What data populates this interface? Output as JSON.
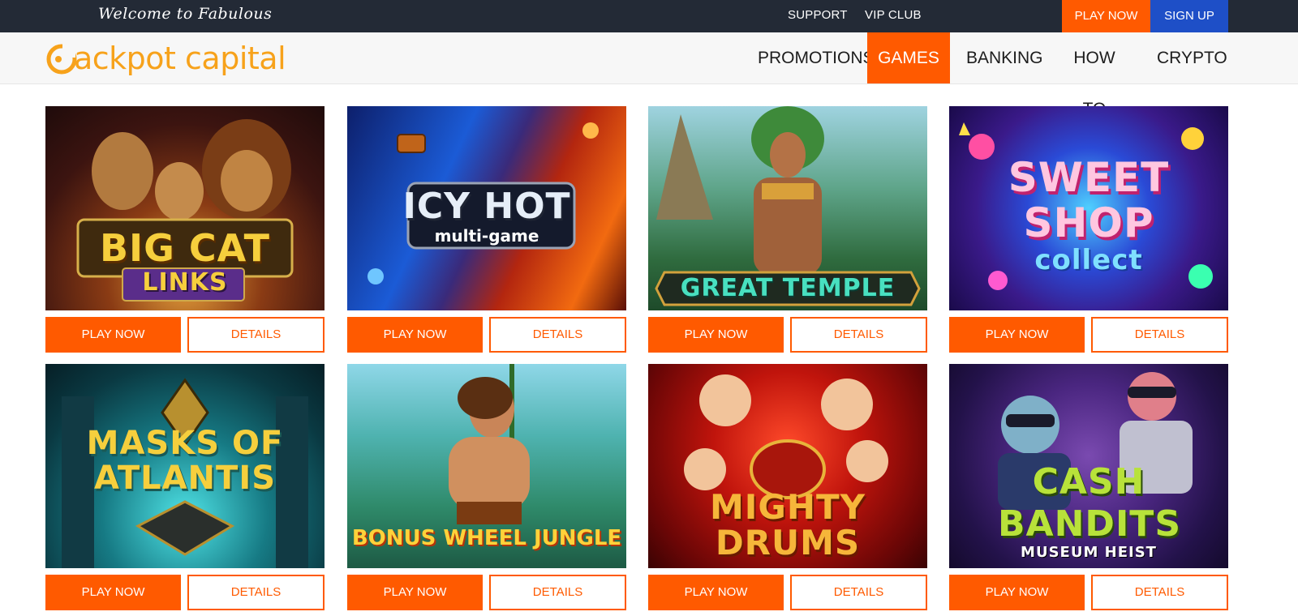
{
  "topbar": {
    "welcome": "Welcome to Fabulous",
    "support": "SUPPORT",
    "vip_club": "VIP CLUB",
    "play_now": "PLAY NOW",
    "sign_up": "SIGN UP"
  },
  "brand": {
    "logo_text": "ackpot capital",
    "colors": {
      "accent": "#ff5a00",
      "topbar": "#232a36",
      "signup": "#1e4fc7",
      "logo": "#f7a21b"
    }
  },
  "nav": {
    "items": [
      "PROMOTIONS",
      "GAMES",
      "BANKING",
      "HOW TO",
      "CRYPTO"
    ],
    "active": "GAMES"
  },
  "games": [
    {
      "title_line1": "BIG CAT",
      "title_line2": "LINKS",
      "play_label": "PLAY NOW",
      "details_label": "DETAILS"
    },
    {
      "title_line1": "ICY HOT",
      "title_line2": "multi-game",
      "play_label": "PLAY NOW",
      "details_label": "DETAILS"
    },
    {
      "title_line1": "GREAT TEMPLE",
      "title_line2": "",
      "play_label": "PLAY NOW",
      "details_label": "DETAILS"
    },
    {
      "title_line1": "SWEET SHOP",
      "title_line2": "collect",
      "play_label": "PLAY NOW",
      "details_label": "DETAILS"
    },
    {
      "title_line1": "MASKS OF",
      "title_line2": "ATLANTIS",
      "play_label": "PLAY NOW",
      "details_label": "DETAILS"
    },
    {
      "title_line1": "BONUS WHEEL JUNGLE",
      "title_line2": "",
      "play_label": "PLAY NOW",
      "details_label": "DETAILS"
    },
    {
      "title_line1": "MIGHTY",
      "title_line2": "DRUMS",
      "play_label": "PLAY NOW",
      "details_label": "DETAILS"
    },
    {
      "title_line1": "CASH BANDITS",
      "title_line2": "MUSEUM HEIST",
      "play_label": "PLAY NOW",
      "details_label": "DETAILS"
    }
  ]
}
